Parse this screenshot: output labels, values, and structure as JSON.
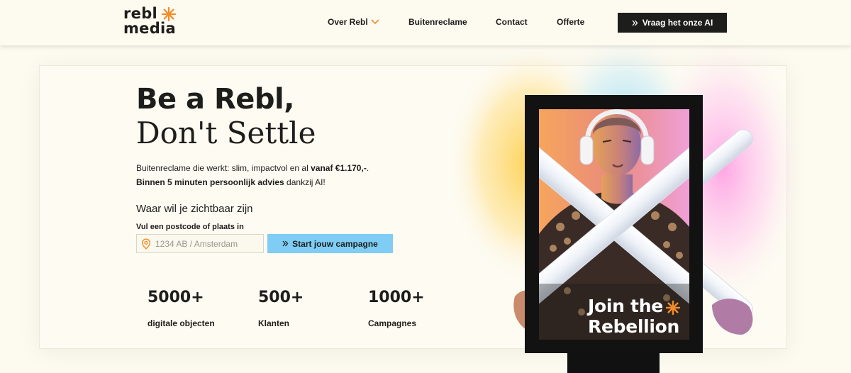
{
  "header": {
    "logo": {
      "line1": "rebl",
      "line2": "media"
    },
    "nav": [
      {
        "label": "Over Rebl"
      },
      {
        "label": "Buitenreclame"
      },
      {
        "label": "Contact"
      },
      {
        "label": "Offerte"
      }
    ],
    "ai_button": "Vraag het onze AI"
  },
  "hero": {
    "title_line1": "Be a Rebl,",
    "title_line2": "Don't Settle",
    "intro_a": "Buitenreclame die werkt: slim, impactvol en al ",
    "intro_b": "vanaf €1.170,-",
    "intro_c": ".",
    "intro_d": "Binnen 5 minuten persoonlijk advies",
    "intro_e": " dankzij AI!",
    "where_title": "Waar wil je zichtbaar zijn",
    "field_label": "Vul een postcode of plaats in",
    "search": {
      "placeholder": "1234 AB / Amsterdam",
      "value": ""
    },
    "start_button": "Start jouw campagne",
    "stats": [
      {
        "number": "5000+",
        "label": "digitale objecten"
      },
      {
        "number": "500+",
        "label": "Klanten"
      },
      {
        "number": "1000+",
        "label": "Campagnes"
      }
    ],
    "billboard": {
      "line1": "Join the",
      "line2": "Rebellion"
    }
  },
  "colors": {
    "background": "#fdfaf0",
    "text": "#1d1d1b",
    "accent_orange": "#f28c28",
    "button_blue": "#7fcdf5",
    "button_dark": "#1d1d1b"
  },
  "icons": {
    "logo_star": "asterisk-star-icon",
    "nav_chevron": "chevron-down-icon",
    "ai_button": "double-chevron-right-icon",
    "search_field": "map-pin-icon",
    "start_button": "double-chevron-right-icon"
  }
}
